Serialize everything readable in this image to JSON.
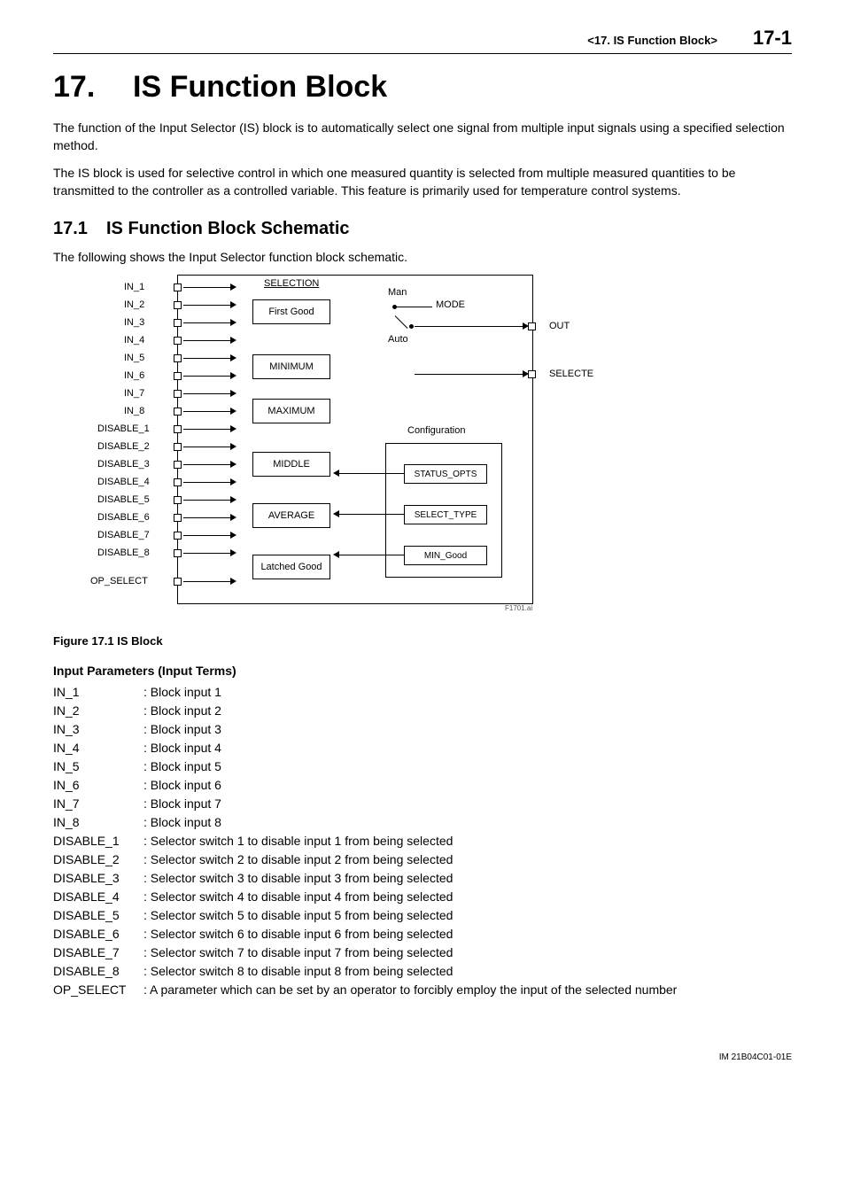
{
  "header": {
    "section_label": "<17.  IS Function Block>",
    "page_number": "17-1"
  },
  "h1": {
    "number": "17.",
    "title": "IS Function Block"
  },
  "intro_p1": "The function of the Input Selector (IS) block is to automatically select one signal from multiple input signals using a specified selection method.",
  "intro_p2": "The IS block is used for selective control in which one measured quantity is selected from multiple measured quantities to be transmitted to the controller as a controlled variable. This feature is primarily used for temperature control systems.",
  "h2": {
    "number": "17.1",
    "title": "IS Function Block Schematic"
  },
  "h2_intro": "The following shows the Input Selector function block schematic.",
  "figure_caption": "Figure 17.1    IS Block",
  "diagram": {
    "inputs": [
      "IN_1",
      "IN_2",
      "IN_3",
      "IN_4",
      "IN_5",
      "IN_6",
      "IN_7",
      "IN_8",
      "DISABLE_1",
      "DISABLE_2",
      "DISABLE_3",
      "DISABLE_4",
      "DISABLE_5",
      "DISABLE_6",
      "DISABLE_7",
      "DISABLE_8",
      "OP_SELECT"
    ],
    "selection_title": "SELECTION",
    "selection_boxes": [
      "First Good",
      "MINIMUM",
      "MAXIMUM",
      "MIDDLE",
      "AVERAGE",
      "Latched Good"
    ],
    "mode_man": "Man",
    "mode_auto": "Auto",
    "mode_label": "MODE",
    "config_title": "Configuration",
    "config_boxes": [
      "STATUS_OPTS",
      "SELECT_TYPE",
      "MIN_Good"
    ],
    "outputs": [
      "OUT",
      "SELECTE"
    ],
    "footer_code": "F1701.ai"
  },
  "input_terms_heading": "Input Parameters (Input Terms)",
  "input_terms": [
    {
      "label": "IN_1",
      "desc": ": Block input 1"
    },
    {
      "label": "IN_2",
      "desc": ": Block input 2"
    },
    {
      "label": "IN_3",
      "desc": ": Block input 3"
    },
    {
      "label": "IN_4",
      "desc": ": Block input 4"
    },
    {
      "label": "IN_5",
      "desc": ": Block input 5"
    },
    {
      "label": "IN_6",
      "desc": ": Block input 6"
    },
    {
      "label": "IN_7",
      "desc": ": Block input 7"
    },
    {
      "label": "IN_8",
      "desc": ": Block input 8"
    },
    {
      "label": "DISABLE_1",
      "desc": ": Selector switch 1 to disable input 1 from being selected"
    },
    {
      "label": "DISABLE_2",
      "desc": ": Selector switch 2 to disable input 2 from being selected"
    },
    {
      "label": "DISABLE_3",
      "desc": ": Selector switch 3 to disable input 3 from being selected"
    },
    {
      "label": "DISABLE_4",
      "desc": ": Selector switch 4 to disable input 4 from being selected"
    },
    {
      "label": "DISABLE_5",
      "desc": ": Selector switch 5 to disable input 5 from being selected"
    },
    {
      "label": "DISABLE_6",
      "desc": ": Selector switch 6 to disable input 6 from being selected"
    },
    {
      "label": "DISABLE_7",
      "desc": ": Selector switch 7 to disable input 7 from being selected"
    },
    {
      "label": "DISABLE_8",
      "desc": ": Selector switch 8 to disable input 8 from being selected"
    },
    {
      "label": "OP_SELECT",
      "desc": ": A parameter which can be set by an operator to forcibly employ the input of the selected number"
    }
  ],
  "footer": "IM 21B04C01-01E"
}
